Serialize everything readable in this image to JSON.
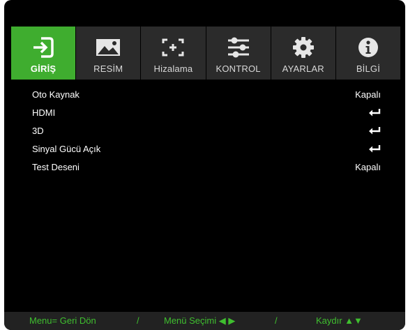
{
  "tabs": [
    {
      "label": "GİRİŞ",
      "icon": "input-icon",
      "active": true
    },
    {
      "label": "RESİM",
      "icon": "picture-icon",
      "active": false
    },
    {
      "label": "Hizalama",
      "icon": "alignment-icon",
      "active": false
    },
    {
      "label": "KONTROL",
      "icon": "sliders-icon",
      "active": false
    },
    {
      "label": "AYARLAR",
      "icon": "gear-icon",
      "active": false
    },
    {
      "label": "BİLGİ",
      "icon": "info-icon",
      "active": false
    }
  ],
  "menu": {
    "items": [
      {
        "label": "Oto Kaynak",
        "value": "Kapalı",
        "type": "value"
      },
      {
        "label": "HDMI",
        "value": "",
        "type": "enter"
      },
      {
        "label": "3D",
        "value": "",
        "type": "enter"
      },
      {
        "label": "Sinyal Gücü Açık",
        "value": "",
        "type": "enter"
      },
      {
        "label": "Test Deseni",
        "value": "Kapalı",
        "type": "value"
      }
    ]
  },
  "footer": {
    "back": "Menu= Geri Dön",
    "sep1": "/",
    "select": "Menü Seçimi ◀ ▶",
    "sep2": "/",
    "scroll": "Kaydır ▲▼"
  },
  "colors": {
    "accent": "#3fad2f",
    "tab_bg": "#2b2b2b",
    "footer_text": "#3fbf2f"
  }
}
